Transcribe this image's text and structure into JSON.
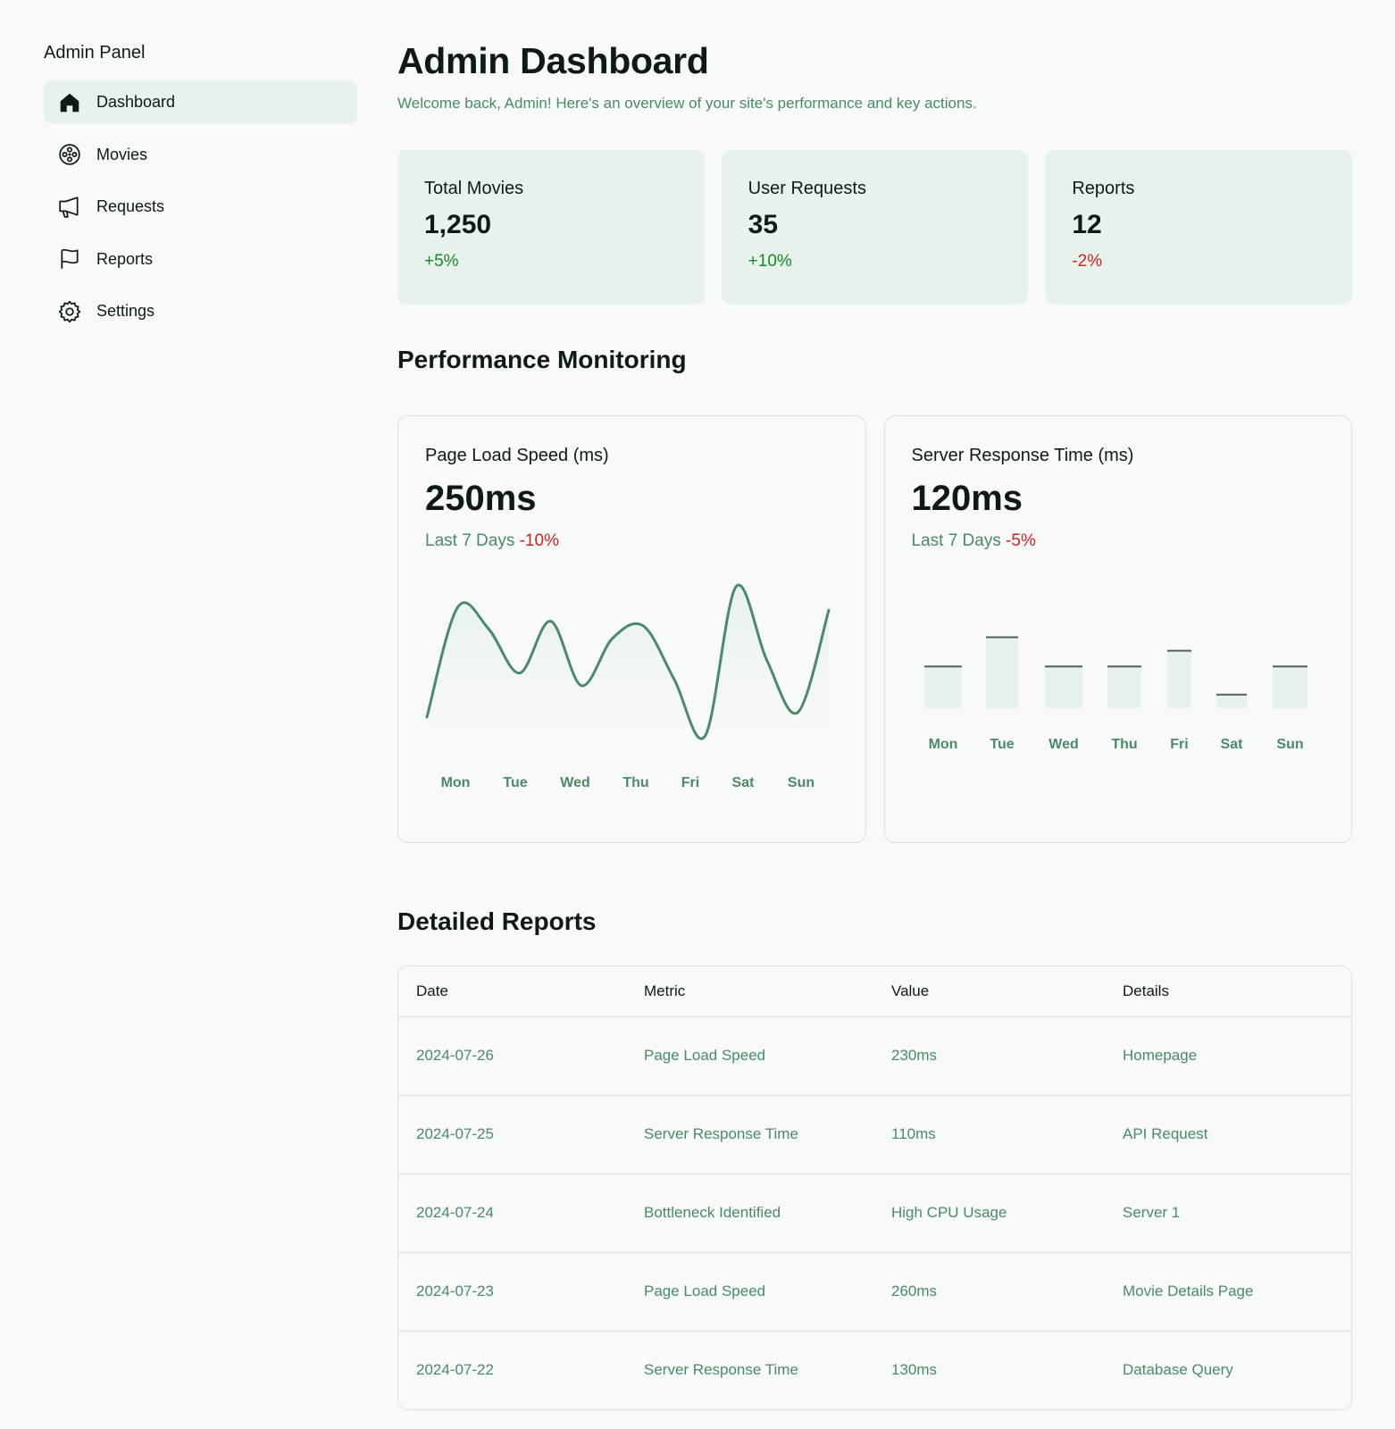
{
  "sidebar": {
    "brand": "Admin Panel",
    "items": [
      {
        "label": "Dashboard",
        "icon": "home-icon",
        "active": true
      },
      {
        "label": "Movies",
        "icon": "film-reel-icon",
        "active": false
      },
      {
        "label": "Requests",
        "icon": "megaphone-icon",
        "active": false
      },
      {
        "label": "Reports",
        "icon": "flag-icon",
        "active": false
      },
      {
        "label": "Settings",
        "icon": "gear-icon",
        "active": false
      }
    ]
  },
  "header": {
    "title": "Admin Dashboard",
    "subtitle": "Welcome back, Admin! Here's an overview of your site's performance and key actions."
  },
  "stats": [
    {
      "label": "Total Movies",
      "value": "1,250",
      "change": "+5%",
      "trend": "up"
    },
    {
      "label": "User Requests",
      "value": "35",
      "change": "+10%",
      "trend": "up"
    },
    {
      "label": "Reports",
      "value": "12",
      "change": "-2%",
      "trend": "down"
    }
  ],
  "performance": {
    "title": "Performance Monitoring",
    "page_load": {
      "label": "Page Load Speed (ms)",
      "value": "250ms",
      "period": "Last 7 Days",
      "change": "-10%"
    },
    "server_response": {
      "label": "Server Response Time (ms)",
      "value": "120ms",
      "period": "Last 7 Days",
      "change": "-5%"
    }
  },
  "chart_data": [
    {
      "type": "line",
      "categories": [
        "Mon",
        "Tue",
        "Wed",
        "Thu",
        "Fri",
        "Sat",
        "Sun"
      ],
      "values": [
        0.12,
        0.82,
        0.68,
        0.4,
        0.73,
        0.32,
        0.62,
        0.7,
        0.36,
        0.0,
        0.95,
        0.48,
        0.15,
        0.8
      ],
      "title": "Page Load Speed (ms)",
      "colors": {
        "line": "#4a8a6a",
        "fill": "#e8f2ec"
      }
    },
    {
      "type": "bar",
      "categories": [
        "Mon",
        "Tue",
        "Wed",
        "Thu",
        "Fri",
        "Sat",
        "Sun"
      ],
      "values": [
        0.4,
        0.68,
        0.4,
        0.4,
        0.55,
        0.13,
        0.4
      ],
      "title": "Server Response Time (ms)",
      "colors": {
        "bar": "#e8f2ec",
        "top": "#525f57"
      }
    }
  ],
  "reports": {
    "title": "Detailed Reports",
    "columns": [
      "Date",
      "Metric",
      "Value",
      "Details"
    ],
    "rows": [
      [
        "2024-07-26",
        "Page Load Speed",
        "230ms",
        "Homepage"
      ],
      [
        "2024-07-25",
        "Server Response Time",
        "110ms",
        "API Request"
      ],
      [
        "2024-07-24",
        "Bottleneck Identified",
        "High CPU Usage",
        "Server 1"
      ],
      [
        "2024-07-23",
        "Page Load Speed",
        "260ms",
        "Movie Details Page"
      ],
      [
        "2024-07-22",
        "Server Response Time",
        "130ms",
        "Database Query"
      ]
    ]
  }
}
